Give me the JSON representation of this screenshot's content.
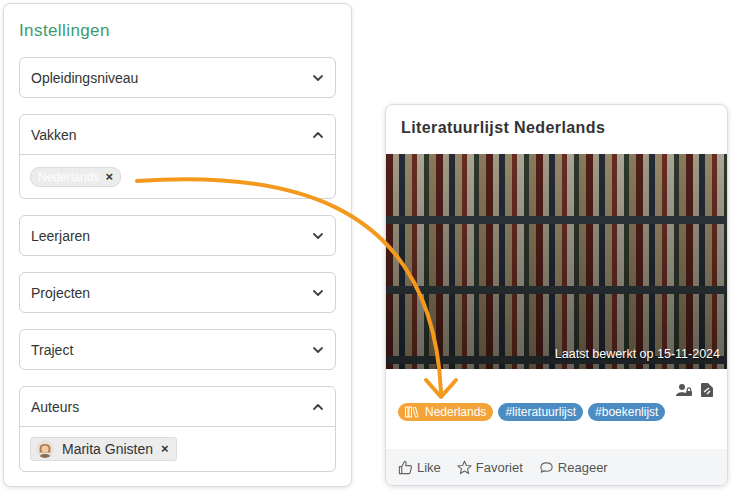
{
  "settings": {
    "title": "Instellingen",
    "sections": [
      {
        "label": "Opleidingsniveau",
        "expanded": false,
        "chips": []
      },
      {
        "label": "Vakken",
        "expanded": true,
        "chips": [
          {
            "label": "Nederlands",
            "remove": "×",
            "kind": "tag"
          }
        ]
      },
      {
        "label": "Leerjaren",
        "expanded": false,
        "chips": []
      },
      {
        "label": "Projecten",
        "expanded": false,
        "chips": []
      },
      {
        "label": "Traject",
        "expanded": false,
        "chips": []
      },
      {
        "label": "Auteurs",
        "expanded": true,
        "chips": [
          {
            "label": "Marita Gnisten",
            "remove": "×",
            "kind": "person"
          }
        ]
      }
    ]
  },
  "card": {
    "title": "Literatuurlijst Nederlands",
    "edited": "Laatst bewerkt op 15-11-2024",
    "tags": [
      {
        "label": "Nederlands",
        "kind": "subject",
        "color": "#f3a338"
      },
      {
        "label": "#literatuurlijst",
        "kind": "hashtag",
        "color": "#4b8cc3"
      },
      {
        "label": "#boekenlijst",
        "kind": "hashtag",
        "color": "#4b8cc3"
      }
    ],
    "actions": [
      {
        "label": "Like"
      },
      {
        "label": "Favoriet"
      },
      {
        "label": "Reageer"
      }
    ]
  }
}
